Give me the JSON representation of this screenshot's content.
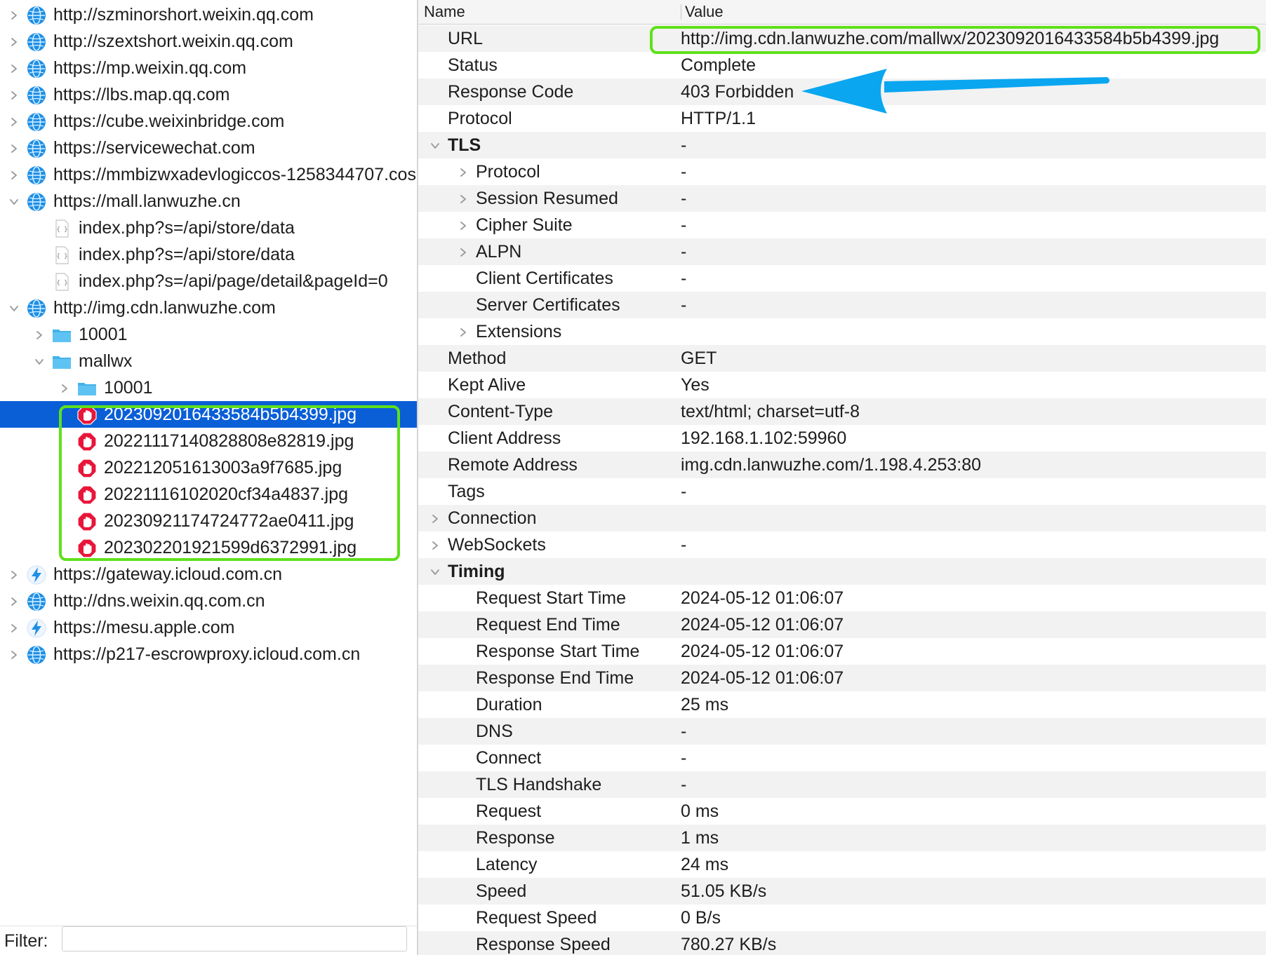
{
  "tree": {
    "items": [
      {
        "label": "http://szminorshort.weixin.qq.com",
        "icon": "globe-icon",
        "expand": "collapsed",
        "indent": 0
      },
      {
        "label": "http://szextshort.weixin.qq.com",
        "icon": "globe-icon",
        "expand": "collapsed",
        "indent": 0
      },
      {
        "label": "https://mp.weixin.qq.com",
        "icon": "globe-icon",
        "expand": "collapsed",
        "indent": 0
      },
      {
        "label": "https://lbs.map.qq.com",
        "icon": "globe-icon",
        "expand": "collapsed",
        "indent": 0
      },
      {
        "label": "https://cube.weixinbridge.com",
        "icon": "globe-icon",
        "expand": "collapsed",
        "indent": 0
      },
      {
        "label": "https://servicewechat.com",
        "icon": "globe-icon",
        "expand": "collapsed",
        "indent": 0
      },
      {
        "label": "https://mmbizwxadevlogiccos-1258344707.cos",
        "icon": "globe-icon",
        "expand": "collapsed",
        "indent": 0
      },
      {
        "label": "https://mall.lanwuzhe.cn",
        "icon": "globe-icon",
        "expand": "expanded",
        "indent": 0
      },
      {
        "label": "index.php?s=/api/store/data",
        "icon": "json-file-icon",
        "expand": "none",
        "indent": 1
      },
      {
        "label": "index.php?s=/api/store/data",
        "icon": "json-file-icon",
        "expand": "none",
        "indent": 1
      },
      {
        "label": "index.php?s=/api/page/detail&pageId=0",
        "icon": "json-file-icon",
        "expand": "none",
        "indent": 1
      },
      {
        "label": "http://img.cdn.lanwuzhe.com",
        "icon": "globe-icon",
        "expand": "expanded",
        "indent": 0
      },
      {
        "label": "10001",
        "icon": "folder-icon",
        "expand": "collapsed",
        "indent": 1
      },
      {
        "label": "mallwx",
        "icon": "folder-icon",
        "expand": "expanded",
        "indent": 1
      },
      {
        "label": "10001",
        "icon": "folder-icon",
        "expand": "collapsed",
        "indent": 2
      },
      {
        "label": "2023092016433584b5b4399.jpg",
        "icon": "stop-icon",
        "expand": "none",
        "indent": 2,
        "selected": true
      },
      {
        "label": "20221117140828808e82819.jpg",
        "icon": "stop-icon",
        "expand": "none",
        "indent": 2
      },
      {
        "label": "202212051613003a9f7685.jpg",
        "icon": "stop-icon",
        "expand": "none",
        "indent": 2
      },
      {
        "label": "20221116102020cf34a4837.jpg",
        "icon": "stop-icon",
        "expand": "none",
        "indent": 2
      },
      {
        "label": "20230921174724772ae0411.jpg",
        "icon": "stop-icon",
        "expand": "none",
        "indent": 2
      },
      {
        "label": "202302201921599d6372991.jpg",
        "icon": "stop-icon",
        "expand": "none",
        "indent": 2
      },
      {
        "label": "https://gateway.icloud.com.cn",
        "icon": "lightning-icon",
        "expand": "collapsed",
        "indent": 0
      },
      {
        "label": "http://dns.weixin.qq.com.cn",
        "icon": "globe-icon",
        "expand": "collapsed",
        "indent": 0
      },
      {
        "label": "https://mesu.apple.com",
        "icon": "lightning-icon",
        "expand": "collapsed",
        "indent": 0
      },
      {
        "label": "https://p217-escrowproxy.icloud.com.cn",
        "icon": "globe-icon",
        "expand": "collapsed",
        "indent": 0
      }
    ]
  },
  "filter": {
    "label": "Filter:",
    "value": ""
  },
  "details": {
    "header": {
      "name": "Name",
      "value": "Value"
    },
    "rows": [
      {
        "name": "URL",
        "value": "http://img.cdn.lanwuzhe.com/mallwx/2023092016433584b5b4399.jpg",
        "indent": 0,
        "expand": "none"
      },
      {
        "name": "Status",
        "value": "Complete",
        "indent": 0,
        "expand": "none"
      },
      {
        "name": "Response Code",
        "value": "403 Forbidden",
        "indent": 0,
        "expand": "none"
      },
      {
        "name": "Protocol",
        "value": "HTTP/1.1",
        "indent": 0,
        "expand": "none"
      },
      {
        "name": "TLS",
        "value": "-",
        "indent": 0,
        "expand": "expanded",
        "bold": true
      },
      {
        "name": "Protocol",
        "value": "-",
        "indent": 1,
        "expand": "collapsed"
      },
      {
        "name": "Session Resumed",
        "value": "-",
        "indent": 1,
        "expand": "collapsed"
      },
      {
        "name": "Cipher Suite",
        "value": "-",
        "indent": 1,
        "expand": "collapsed"
      },
      {
        "name": "ALPN",
        "value": "-",
        "indent": 1,
        "expand": "collapsed"
      },
      {
        "name": "Client Certificates",
        "value": "-",
        "indent": 1,
        "expand": "none"
      },
      {
        "name": "Server Certificates",
        "value": "-",
        "indent": 1,
        "expand": "none"
      },
      {
        "name": "Extensions",
        "value": "",
        "indent": 1,
        "expand": "collapsed"
      },
      {
        "name": "Method",
        "value": "GET",
        "indent": 0,
        "expand": "none"
      },
      {
        "name": "Kept Alive",
        "value": "Yes",
        "indent": 0,
        "expand": "none"
      },
      {
        "name": "Content-Type",
        "value": "text/html; charset=utf-8",
        "indent": 0,
        "expand": "none"
      },
      {
        "name": "Client Address",
        "value": "192.168.1.102:59960",
        "indent": 0,
        "expand": "none"
      },
      {
        "name": "Remote Address",
        "value": "img.cdn.lanwuzhe.com/1.198.4.253:80",
        "indent": 0,
        "expand": "none"
      },
      {
        "name": "Tags",
        "value": "-",
        "indent": 0,
        "expand": "none"
      },
      {
        "name": "Connection",
        "value": "",
        "indent": 0,
        "expand": "collapsed"
      },
      {
        "name": "WebSockets",
        "value": "-",
        "indent": 0,
        "expand": "collapsed"
      },
      {
        "name": "Timing",
        "value": "",
        "indent": 0,
        "expand": "expanded",
        "bold": true
      },
      {
        "name": "Request Start Time",
        "value": "2024-05-12 01:06:07",
        "indent": 1,
        "expand": "none"
      },
      {
        "name": "Request End Time",
        "value": "2024-05-12 01:06:07",
        "indent": 1,
        "expand": "none"
      },
      {
        "name": "Response Start Time",
        "value": "2024-05-12 01:06:07",
        "indent": 1,
        "expand": "none"
      },
      {
        "name": "Response End Time",
        "value": "2024-05-12 01:06:07",
        "indent": 1,
        "expand": "none"
      },
      {
        "name": "Duration",
        "value": "25 ms",
        "indent": 1,
        "expand": "none"
      },
      {
        "name": "DNS",
        "value": "-",
        "indent": 1,
        "expand": "none"
      },
      {
        "name": "Connect",
        "value": "-",
        "indent": 1,
        "expand": "none"
      },
      {
        "name": "TLS Handshake",
        "value": "-",
        "indent": 1,
        "expand": "none"
      },
      {
        "name": "Request",
        "value": "0 ms",
        "indent": 1,
        "expand": "none"
      },
      {
        "name": "Response",
        "value": "1 ms",
        "indent": 1,
        "expand": "none"
      },
      {
        "name": "Latency",
        "value": "24 ms",
        "indent": 1,
        "expand": "none"
      },
      {
        "name": "Speed",
        "value": "51.05 KB/s",
        "indent": 1,
        "expand": "none"
      },
      {
        "name": "Request Speed",
        "value": "0 B/s",
        "indent": 1,
        "expand": "none"
      },
      {
        "name": "Response Speed",
        "value": "780.27 KB/s",
        "indent": 1,
        "expand": "none"
      }
    ]
  },
  "annotations": {
    "highlight_color": "#5fe11a",
    "arrow_color": "#0aa6f0"
  },
  "colors": {
    "selection": "#0a5fd7",
    "stripe": "#f2f2f2",
    "globe": "#1e8fe6",
    "stop": "#e8163a",
    "folder": "#5ec3f2"
  }
}
